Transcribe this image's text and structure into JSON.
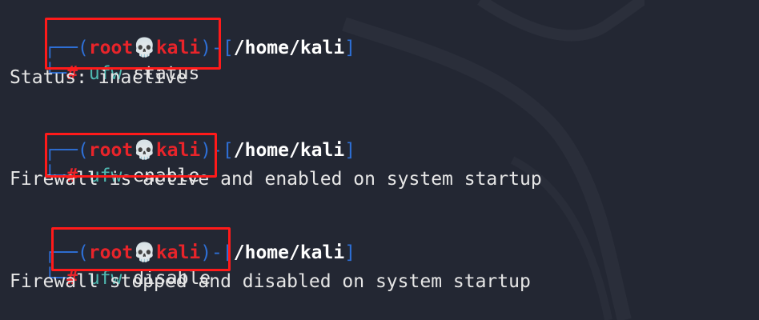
{
  "prompt": {
    "user": "root",
    "skull": "💀",
    "host": "kali",
    "dir": "/home/kali",
    "hash": "#"
  },
  "blocks": [
    {
      "cmd": "ufw",
      "args": " status",
      "output": "Status: inactive"
    },
    {
      "cmd": "ufw",
      "args": " enable",
      "output": "Firewall is active and enabled on system startup"
    },
    {
      "cmd": "ufw",
      "args": " disable",
      "output": "Firewall stopped and disabled on system startup"
    }
  ],
  "colors": {
    "background": "#232733",
    "frame": "#2e6fd6",
    "prompt_user": "#e8242a",
    "command": "#4fb8b0",
    "text": "#e6e6e6",
    "highlight": "#ff1a1a"
  }
}
